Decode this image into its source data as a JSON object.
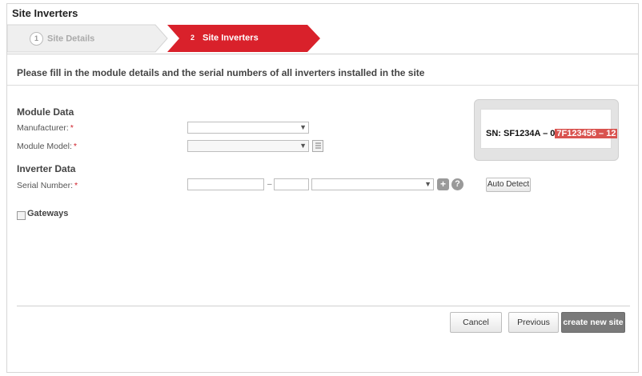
{
  "window": {
    "title": "Site Inverters"
  },
  "wizard": {
    "steps": [
      {
        "number": "1",
        "label": "Site Details"
      },
      {
        "number": "2",
        "label": "Site Inverters"
      }
    ],
    "active_color": "#d9212b"
  },
  "instructions": "Please fill in the module details and the serial numbers of all inverters installed in the site",
  "module_data": {
    "heading": "Module Data",
    "manufacturer_label": "Manufacturer:",
    "module_model_label": "Module Model:",
    "required_mark": "*",
    "manufacturer_value": "",
    "module_model_value": ""
  },
  "inverter_data": {
    "heading": "Inverter Data",
    "serial_label": "Serial Number:",
    "required_mark": "*",
    "serial_part1": "",
    "dash": "–",
    "serial_part2": "",
    "serial_part3": "",
    "auto_detect_label": "Auto Detect"
  },
  "sample": {
    "prefix": "SN: SF1234A – 0",
    "highlight": "7F123456 – 12"
  },
  "gateways": {
    "label": "Gateways",
    "checked": false
  },
  "footer": {
    "cancel_label": "Cancel",
    "previous_label": "Previous",
    "create_label": "create new site"
  }
}
